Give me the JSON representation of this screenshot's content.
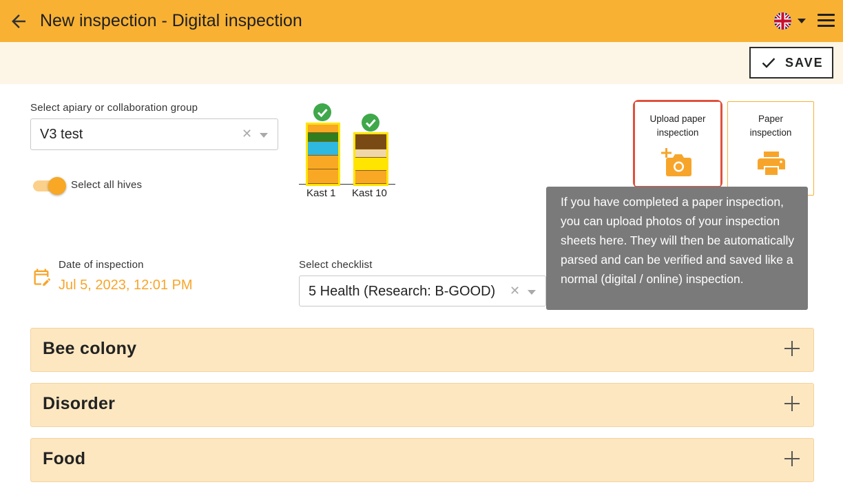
{
  "header": {
    "title": "New inspection - Digital inspection",
    "back_icon": "arrow-back-icon",
    "language_flag_icon": "uk-flag-icon",
    "menu_icon": "hamburger-menu-icon",
    "bar_color": "#f8b133"
  },
  "toolbar": {
    "save_label": "SAVE",
    "save_icon": "check-icon"
  },
  "apiary": {
    "label": "Select apiary or collaboration group",
    "value": "V3 test",
    "clear_icon": "clear-icon",
    "dropdown_icon": "chevron-down-icon"
  },
  "select_all": {
    "label": "Select all hives",
    "checked": true
  },
  "hives": [
    {
      "name": "Kast 1",
      "selected": true,
      "layers": [
        "#f8a824",
        "#2e7d1e",
        "#2fb8e0",
        "#f8a824",
        "#f8a824"
      ]
    },
    {
      "name": "Kast 10",
      "selected": true,
      "layers": [
        "#7a4a14",
        "#f0d7a8",
        "#ffe500",
        "#f8a824"
      ]
    }
  ],
  "upload_paper": {
    "label": "Upload paper inspection",
    "icon": "add-photo-camera-icon"
  },
  "paper_inspection": {
    "label": "Paper inspection",
    "icon": "printer-icon"
  },
  "tooltip": {
    "text": "If you have completed a paper inspection, you can upload photos of your inspection sheets here. They will then be automatically parsed and can be verified and saved like a normal (digital / online) inspection."
  },
  "date": {
    "label": "Date of inspection",
    "value": "Jul 5, 2023, 12:01 PM",
    "icon": "edit-calendar-icon",
    "accent": "#f7a52a"
  },
  "checklist": {
    "label": "Select checklist",
    "value": "5 Health (Research: B-GOOD)"
  },
  "sections": [
    {
      "title": "Bee colony"
    },
    {
      "title": "Disorder"
    },
    {
      "title": "Food"
    }
  ]
}
